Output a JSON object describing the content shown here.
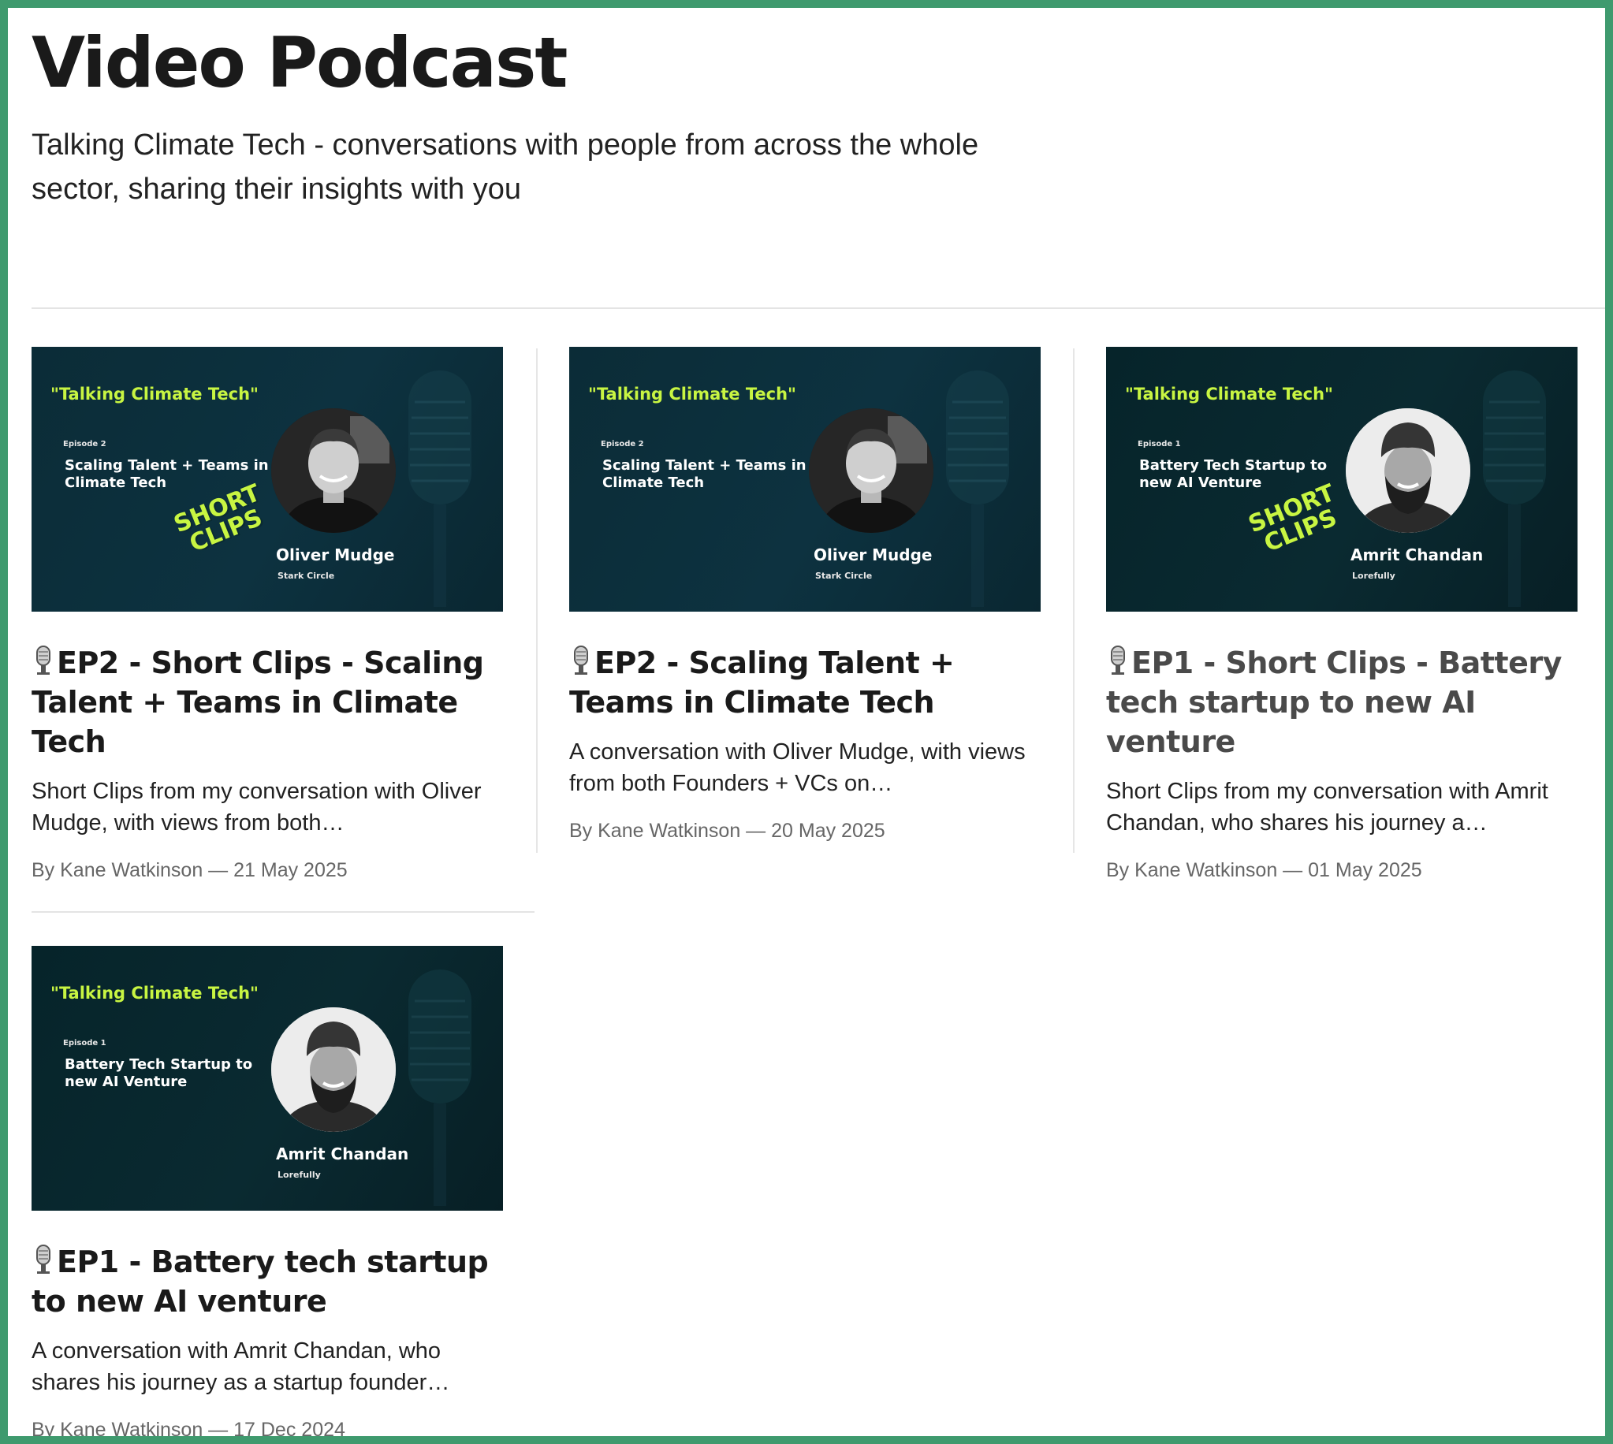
{
  "header": {
    "title": "Video Podcast",
    "subtitle": "Talking Climate Tech - conversations with people from across the whole sector, sharing their insights with you"
  },
  "posts": [
    {
      "thumbnail": {
        "show": "\"Talking Climate Tech\"",
        "episode": "Episode 2",
        "topic": "Scaling Talent + Teams in Climate Tech",
        "guest": "Oliver Mudge",
        "company": "Stark Circle",
        "badge_line1": "SHORT",
        "badge_line2": "CLIPS"
      },
      "title": "EP2 - Short Clips - Scaling Talent + Teams in Climate Tech",
      "description": "Short Clips from my conversation with Oliver Mudge, with views from both…",
      "meta": "By Kane Watkinson — 21 May 2025"
    },
    {
      "thumbnail": {
        "show": "\"Talking Climate Tech\"",
        "episode": "Episode 2",
        "topic": "Scaling Talent + Teams in Climate Tech",
        "guest": "Oliver Mudge",
        "company": "Stark Circle"
      },
      "title": "EP2 - Scaling Talent + Teams in Climate Tech",
      "description": "A conversation with Oliver Mudge, with views from both Founders + VCs on…",
      "meta": "By Kane Watkinson — 20 May 2025"
    },
    {
      "thumbnail": {
        "show": "\"Talking Climate Tech\"",
        "episode": "Episode 1",
        "topic": "Battery Tech Startup to new AI Venture",
        "guest": "Amrit Chandan",
        "company": "Lorefully",
        "badge_line1": "SHORT",
        "badge_line2": "CLIPS"
      },
      "title": "EP1 - Short Clips - Battery tech startup to new AI venture",
      "description": "Short Clips from my conversation with Amrit Chandan, who shares his journey a…",
      "meta": "By Kane Watkinson — 01 May 2025"
    },
    {
      "thumbnail": {
        "show": "\"Talking Climate Tech\"",
        "episode": "Episode 1",
        "topic": "Battery Tech Startup to new AI Venture",
        "guest": "Amrit Chandan",
        "company": "Lorefully"
      },
      "title": "EP1 - Battery tech startup to new AI venture",
      "description": "A conversation with Amrit Chandan, who shares his journey as a startup founder…",
      "meta": "By Kane Watkinson — 17 Dec 2024"
    }
  ],
  "colors": {
    "frame_border": "#3f9a6e",
    "thumb_bg": "#0b2c37",
    "accent_lime": "#c8f542"
  },
  "icons": {
    "title_prefix": "microphone-icon"
  }
}
